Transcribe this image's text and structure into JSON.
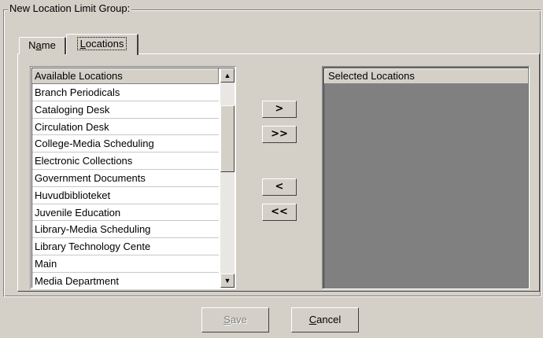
{
  "group": {
    "title": "New  Location Limit Group:"
  },
  "tabs": [
    {
      "pre": "N",
      "accel": "a",
      "post": "me",
      "active": false
    },
    {
      "pre": "",
      "accel": "L",
      "post": "ocations",
      "active": true
    }
  ],
  "available": {
    "header": "Available Locations",
    "items": [
      "Branch Periodicals",
      "Cataloging Desk",
      "Circulation Desk",
      "College-Media Scheduling",
      "Electronic Collections",
      "Government Documents",
      "Huvudbiblioteket",
      "Juvenile Education",
      "Library-Media Scheduling",
      "Library Technology Cente",
      "Main",
      "Media Department"
    ]
  },
  "selected": {
    "header": "Selected Locations",
    "items": []
  },
  "move_buttons": {
    "add_one": ">",
    "add_all": ">>",
    "remove_one": "<",
    "remove_all": "<<"
  },
  "buttons": {
    "save": {
      "accel": "S",
      "rest": "ave",
      "enabled": false
    },
    "cancel": {
      "accel": "C",
      "rest": "ancel",
      "enabled": true
    }
  },
  "icons": {
    "scroll_up": "triangle-up",
    "scroll_down": "triangle-down"
  }
}
